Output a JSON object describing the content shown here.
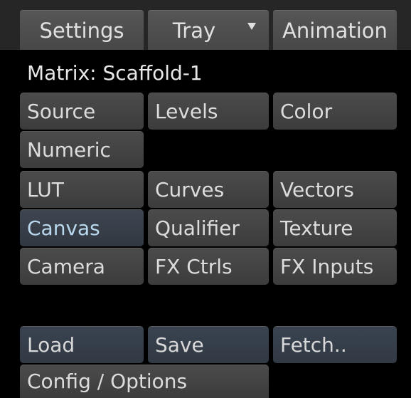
{
  "tabs": {
    "settings": "Settings",
    "tray": "Tray",
    "animation": "Animation"
  },
  "icons": {
    "tray_dropdown": "chevron-down-icon"
  },
  "matrix_label": "Matrix: Scaffold-1",
  "buttons": {
    "source": "Source",
    "levels": "Levels",
    "color": "Color",
    "numeric": "Numeric",
    "lut": "LUT",
    "curves": "Curves",
    "vectors": "Vectors",
    "canvas": "Canvas",
    "qualifier": "Qualifier",
    "texture": "Texture",
    "camera": "Camera",
    "fx_ctrls": "FX Ctrls",
    "fx_inputs": "FX Inputs",
    "load": "Load",
    "save": "Save",
    "fetch": "Fetch..",
    "config": "Config / Options"
  },
  "selected": "Canvas",
  "colors": {
    "background": "#000000",
    "button": "#444444",
    "selected_text": "#b9d8ee",
    "io_button": "#353d48"
  }
}
